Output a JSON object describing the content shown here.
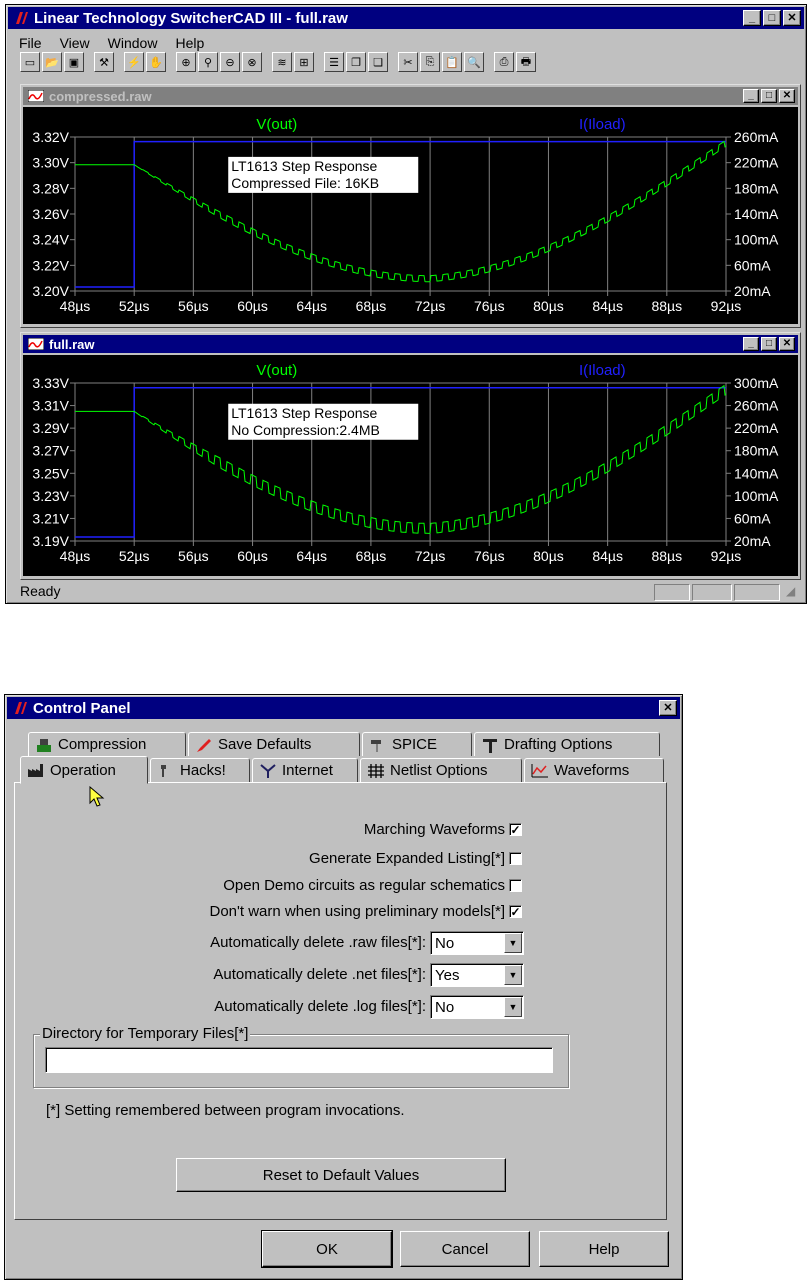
{
  "main_window": {
    "title": "Linear Technology SwitcherCAD III - full.raw",
    "menu": [
      "File",
      "View",
      "Window",
      "Help"
    ],
    "status": "Ready"
  },
  "plot_top": {
    "title": "compressed.raw",
    "trace_left": "V(out)",
    "trace_right": "I(Iload)",
    "annotation_line1": "LT1613 Step Response",
    "annotation_line2": "Compressed File: 16KB",
    "y_left_ticks": [
      "3.32V",
      "3.30V",
      "3.28V",
      "3.26V",
      "3.24V",
      "3.22V",
      "3.20V"
    ],
    "y_right_ticks": [
      "260mA",
      "220mA",
      "180mA",
      "140mA",
      "100mA",
      "60mA",
      "20mA"
    ],
    "x_ticks": [
      "48µs",
      "52µs",
      "56µs",
      "60µs",
      "64µs",
      "68µs",
      "72µs",
      "76µs",
      "80µs",
      "84µs",
      "88µs",
      "92µs"
    ]
  },
  "plot_bottom": {
    "title": "full.raw",
    "trace_left": "V(out)",
    "trace_right": "I(Iload)",
    "annotation_line1": "LT1613 Step Response",
    "annotation_line2": "No Compression:2.4MB",
    "y_left_ticks": [
      "3.33V",
      "3.31V",
      "3.29V",
      "3.27V",
      "3.25V",
      "3.23V",
      "3.21V",
      "3.19V"
    ],
    "y_right_ticks": [
      "300mA",
      "260mA",
      "220mA",
      "180mA",
      "140mA",
      "100mA",
      "60mA",
      "20mA"
    ],
    "x_ticks": [
      "48µs",
      "52µs",
      "56µs",
      "60µs",
      "64µs",
      "68µs",
      "72µs",
      "76µs",
      "80µs",
      "84µs",
      "88µs",
      "92µs"
    ]
  },
  "colors": {
    "vout": "#00ff00",
    "iload": "#2020ff",
    "grid": "#808080",
    "plot_bg": "#000000",
    "titlebar": "#000080"
  },
  "dialog": {
    "title": "Control Panel",
    "tabs_back": [
      "Compression",
      "Save Defaults",
      "SPICE",
      "Drafting Options"
    ],
    "tabs_front": [
      "Operation",
      "Hacks!",
      "Internet",
      "Netlist Options",
      "Waveforms"
    ],
    "checkboxes": [
      {
        "label": "Marching Waveforms",
        "checked": true,
        "mark": "✓"
      },
      {
        "label": "Generate Expanded Listing[*]",
        "checked": false,
        "mark": ""
      },
      {
        "label": "Open Demo circuits as regular schematics",
        "checked": false,
        "mark": ""
      },
      {
        "label": "Don't warn when using preliminary models[*]",
        "checked": true,
        "mark": "✓"
      }
    ],
    "selects": [
      {
        "label": "Automatically delete .raw files[*]:",
        "value": "No"
      },
      {
        "label": "Automatically delete .net files[*]:",
        "value": "Yes"
      },
      {
        "label": "Automatically delete .log files[*]:",
        "value": "No"
      }
    ],
    "dir_group_label": "Directory for Temporary Files[*]",
    "dir_value": "",
    "note": "[*] Setting remembered between program invocations.",
    "reset_button": "Reset to Default Values",
    "ok": "OK",
    "cancel": "Cancel",
    "help": "Help"
  }
}
